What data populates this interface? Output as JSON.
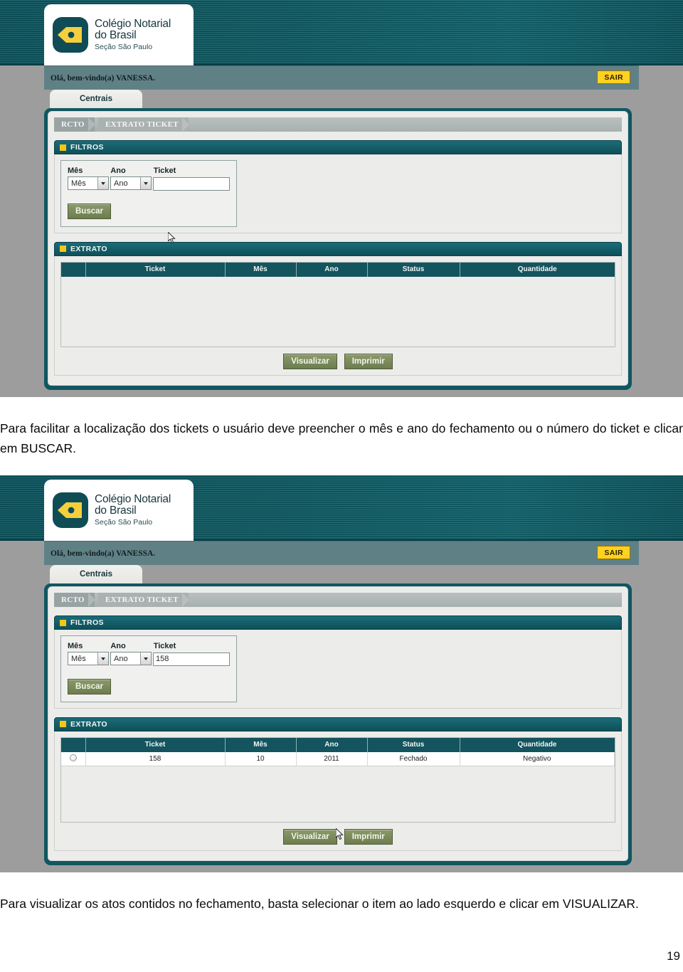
{
  "document": {
    "page_number": "19",
    "caption_1": "Para facilitar a localização dos tickets o usuário deve preencher o mês e ano do fechamento ou o número do ticket e clicar em BUSCAR.",
    "caption_2": "Para visualizar os atos contidos no fechamento, basta selecionar o item ao lado esquerdo e clicar em VISUALIZAR."
  },
  "brand": {
    "line1": "Colégio Notarial",
    "line2": "do Brasil",
    "line3": "Seção São Paulo",
    "logo_icon": "pen-nib-icon",
    "teal": "#0f5761",
    "accent_yellow": "#ffd21f"
  },
  "header": {
    "greeting": "Olá, bem-vindo(a) VANESSA.",
    "logout_label": "SAIR"
  },
  "tabs": [
    {
      "label": "Centrais",
      "active": true
    }
  ],
  "breadcrumb": [
    {
      "label": "RCTO"
    },
    {
      "label": "EXTRATO TICKET"
    }
  ],
  "filtros": {
    "title": "FILTROS",
    "fields": {
      "mes_label": "Mês",
      "mes_value": "Mês",
      "ano_label": "Ano",
      "ano_value": "Ano",
      "ticket_label": "Ticket",
      "ticket_placeholder": ""
    },
    "search_label": "Buscar"
  },
  "extrato": {
    "title": "EXTRATO",
    "columns": [
      "",
      "Ticket",
      "Mês",
      "Ano",
      "Status",
      "Quantidade"
    ],
    "actions": {
      "view_label": "Visualizar",
      "print_label": "Imprimir"
    }
  },
  "screen_1": {
    "ticket_value": "",
    "rows": []
  },
  "screen_2": {
    "ticket_value": "158",
    "rows": [
      {
        "selected": false,
        "ticket": "158",
        "mes": "10",
        "ano": "2011",
        "status": "Fechado",
        "quantidade": "Negativo"
      }
    ]
  }
}
